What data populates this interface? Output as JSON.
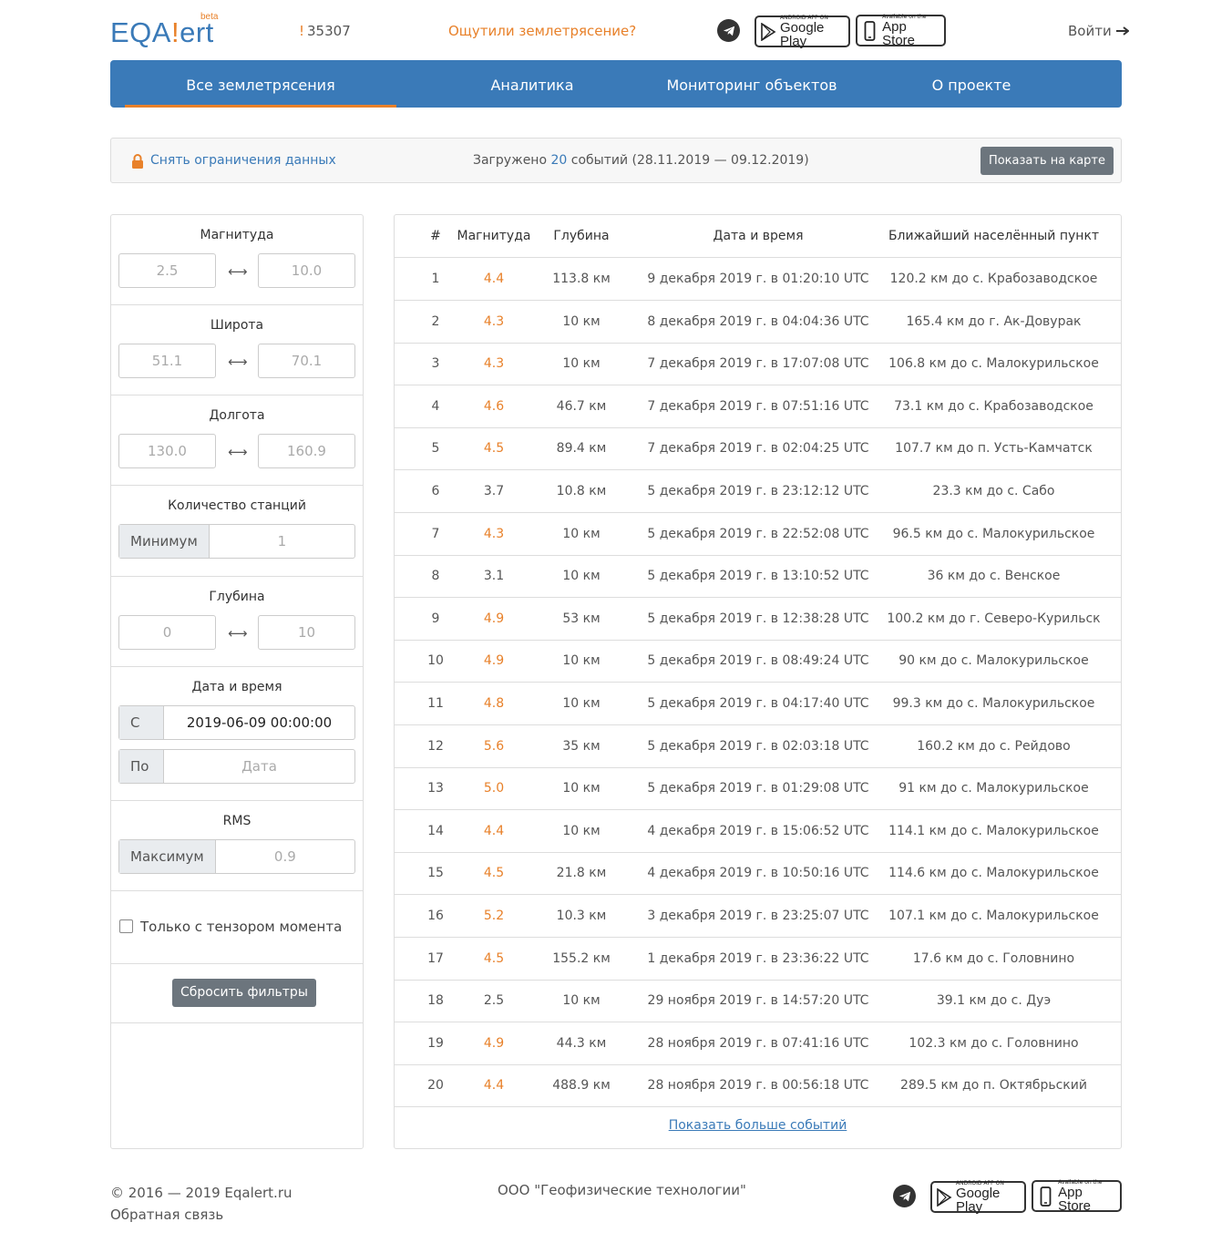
{
  "header": {
    "logo_main": "EQA",
    "logo_bang": "!",
    "logo_tail": "ert",
    "logo_beta": "beta",
    "count_bang": "!",
    "count": "35307",
    "felt_link": "Ощутили землетрясение?",
    "google_play_small": "ANDROID APP ON",
    "google_play_big": "Google Play",
    "app_store_small": "Available on the",
    "app_store_big": "App Store",
    "login": "Войти"
  },
  "nav": {
    "items": [
      {
        "label": "Все землетрясения"
      },
      {
        "label": "Аналитика"
      },
      {
        "label": "Мониторинг объектов"
      },
      {
        "label": "О проекте"
      }
    ]
  },
  "info": {
    "unlock": "Снять ограничения данных",
    "loaded_prefix": "Загружено",
    "loaded_count": "20",
    "loaded_suffix": "событий (28.11.2019 — 09.12.2019)",
    "map_button": "Показать на карте"
  },
  "filters": {
    "magnitude": {
      "title": "Магнитуда",
      "min": "2.5",
      "max": "10.0"
    },
    "latitude": {
      "title": "Широта",
      "min": "51.1",
      "max": "70.1"
    },
    "longitude": {
      "title": "Долгота",
      "min": "130.0",
      "max": "160.9"
    },
    "stations": {
      "title": "Количество станций",
      "addon": "Минимум",
      "placeholder": "1"
    },
    "depth": {
      "title": "Глубина",
      "min": "0",
      "max": "10"
    },
    "datetime": {
      "title": "Дата и время",
      "from_addon": "С",
      "from_value": "2019-06-09 00:00:00",
      "to_addon": "По",
      "to_placeholder": "Дата"
    },
    "rms": {
      "title": "RMS",
      "addon": "Максимум",
      "placeholder": "0.9"
    },
    "tensor_label": "Только с тензором момента",
    "reset_button": "Сбросить фильтры"
  },
  "table": {
    "headers": {
      "num": "#",
      "mag": "Магнитуда",
      "depth": "Глубина",
      "datetime": "Дата и время",
      "place": "Ближайший населённый пункт"
    },
    "rows": [
      {
        "num": "1",
        "mag": "4.4",
        "depth": "113.8 км",
        "datetime": "9 декабря 2019 г. в 01:20:10 UTC",
        "place": "120.2 км до с. Крабозаводское"
      },
      {
        "num": "2",
        "mag": "4.3",
        "depth": "10 км",
        "datetime": "8 декабря 2019 г. в 04:04:36 UTC",
        "place": "165.4 км до г. Ак-Довурак"
      },
      {
        "num": "3",
        "mag": "4.3",
        "depth": "10 км",
        "datetime": "7 декабря 2019 г. в 17:07:08 UTC",
        "place": "106.8 км до с. Малокурильское"
      },
      {
        "num": "4",
        "mag": "4.6",
        "depth": "46.7 км",
        "datetime": "7 декабря 2019 г. в 07:51:16 UTC",
        "place": "73.1 км до с. Крабозаводское"
      },
      {
        "num": "5",
        "mag": "4.5",
        "depth": "89.4 км",
        "datetime": "7 декабря 2019 г. в 02:04:25 UTC",
        "place": "107.7 км до п. Усть-Камчатск"
      },
      {
        "num": "6",
        "mag": "3.7",
        "depth": "10.8 км",
        "datetime": "5 декабря 2019 г. в 23:12:12 UTC",
        "place": "23.3 км до с. Сабо"
      },
      {
        "num": "7",
        "mag": "4.3",
        "depth": "10 км",
        "datetime": "5 декабря 2019 г. в 22:52:08 UTC",
        "place": "96.5 км до с. Малокурильское"
      },
      {
        "num": "8",
        "mag": "3.1",
        "depth": "10 км",
        "datetime": "5 декабря 2019 г. в 13:10:52 UTC",
        "place": "36 км до с. Венское"
      },
      {
        "num": "9",
        "mag": "4.9",
        "depth": "53 км",
        "datetime": "5 декабря 2019 г. в 12:38:28 UTC",
        "place": "100.2 км до г. Северо-Курильск"
      },
      {
        "num": "10",
        "mag": "4.9",
        "depth": "10 км",
        "datetime": "5 декабря 2019 г. в 08:49:24 UTC",
        "place": "90 км до с. Малокурильское"
      },
      {
        "num": "11",
        "mag": "4.8",
        "depth": "10 км",
        "datetime": "5 декабря 2019 г. в 04:17:40 UTC",
        "place": "99.3 км до с. Малокурильское"
      },
      {
        "num": "12",
        "mag": "5.6",
        "depth": "35 км",
        "datetime": "5 декабря 2019 г. в 02:03:18 UTC",
        "place": "160.2 км до с. Рейдово"
      },
      {
        "num": "13",
        "mag": "5.0",
        "depth": "10 км",
        "datetime": "5 декабря 2019 г. в 01:29:08 UTC",
        "place": "91 км до с. Малокурильское"
      },
      {
        "num": "14",
        "mag": "4.4",
        "depth": "10 км",
        "datetime": "4 декабря 2019 г. в 15:06:52 UTC",
        "place": "114.1 км до с. Малокурильское"
      },
      {
        "num": "15",
        "mag": "4.5",
        "depth": "21.8 км",
        "datetime": "4 декабря 2019 г. в 10:50:16 UTC",
        "place": "114.6 км до с. Малокурильское"
      },
      {
        "num": "16",
        "mag": "5.2",
        "depth": "10.3 км",
        "datetime": "3 декабря 2019 г. в 23:25:07 UTC",
        "place": "107.1 км до с. Малокурильское"
      },
      {
        "num": "17",
        "mag": "4.5",
        "depth": "155.2 км",
        "datetime": "1 декабря 2019 г. в 23:36:22 UTC",
        "place": "17.6 км до с. Головнино"
      },
      {
        "num": "18",
        "mag": "2.5",
        "depth": "10 км",
        "datetime": "29 ноября 2019 г. в 14:57:20 UTC",
        "place": "39.1 км до с. Дуэ"
      },
      {
        "num": "19",
        "mag": "4.9",
        "depth": "44.3 км",
        "datetime": "28 ноября 2019 г. в 07:41:16 UTC",
        "place": "102.3 км до с. Головнино"
      },
      {
        "num": "20",
        "mag": "4.4",
        "depth": "488.9 км",
        "datetime": "28 ноября 2019 г. в 00:56:18 UTC",
        "place": "289.5 км до п. Октябрьский"
      }
    ],
    "more": "Показать больше событий"
  },
  "footer": {
    "copyright": "© 2016 — 2019 Eqalert.ru",
    "feedback": "Обратная связь",
    "org": "ООО \"Геофизические технологии\""
  },
  "colors": {
    "accent": "#e8812a",
    "brand": "#3a7ab8",
    "button": "#6c757d"
  }
}
